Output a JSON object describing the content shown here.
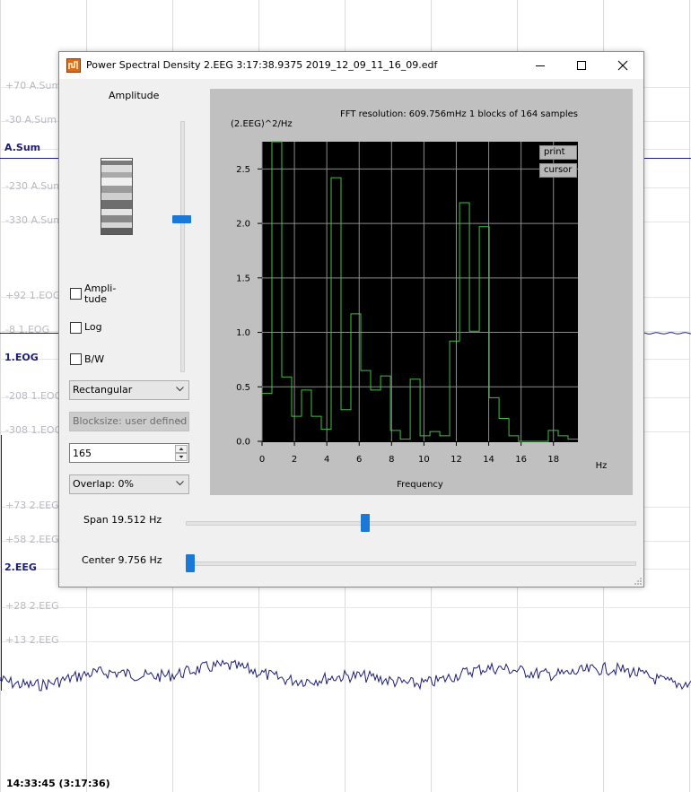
{
  "dialog": {
    "title": "Power Spectral Density    2.EEG   3:17:38.9375   2019_12_09_11_16_09.edf",
    "amplitude_label": "Amplitude",
    "checkboxes": {
      "amplitude": "Ampli-tude",
      "log": "Log",
      "bw": "B/W"
    },
    "window_select": "Rectangular",
    "blocksize_select": "Blocksize: user defined",
    "blocks_value": "165",
    "overlap_select": "Overlap: 0%",
    "span_label": "Span 19.512 Hz",
    "center_label": "Center 9.756 Hz",
    "print_label": "print",
    "cursor_label": "cursor"
  },
  "background": {
    "labels": [
      {
        "text": "+70 A.Sum",
        "channel": false
      },
      {
        "text": "-30 A.Sum",
        "channel": false
      },
      {
        "text": "A.Sum",
        "channel": true
      },
      {
        "text": "-230 A.Sum",
        "channel": false
      },
      {
        "text": "-330 A.Sum",
        "channel": false
      },
      {
        "text": "+92 1.EOG",
        "channel": false
      },
      {
        "text": "-8 1.EOG",
        "channel": false
      },
      {
        "text": "1.EOG",
        "channel": true
      },
      {
        "text": "-208 1.EOG",
        "channel": false
      },
      {
        "text": "-308 1.EOG",
        "channel": false
      },
      {
        "text": "+73 2.EEG",
        "channel": false
      },
      {
        "text": "+58 2.EEG",
        "channel": false
      },
      {
        "text": "2.EEG",
        "channel": true
      },
      {
        "text": "+28 2.EEG",
        "channel": false
      },
      {
        "text": "+13 2.EEG",
        "channel": false
      }
    ],
    "timestamp": "14:33:45 (3:17:36)",
    "trace_color": "#1d1d7a"
  },
  "chart_data": {
    "type": "line",
    "title": "FFT resolution: 609.756mHz   1 blocks of 164 samples",
    "ylabel": "(2.EEG)^2/Hz",
    "xlabel": "Frequency",
    "x_unit": "Hz",
    "xlim": [
      0,
      19.512
    ],
    "ylim": [
      0,
      2.75
    ],
    "x_ticks": [
      0,
      2,
      4,
      6,
      8,
      10,
      12,
      14,
      16,
      18
    ],
    "y_ticks": [
      0.0,
      0.5,
      1.0,
      1.5,
      2.0,
      2.5
    ],
    "y_tick_labels": [
      "0.0",
      "0.5",
      "1.0",
      "1.5",
      "2.0",
      "2.5"
    ],
    "grid": true,
    "step": true,
    "line_color": "#40c040",
    "background_color": "#000000",
    "x": [
      0.0,
      0.61,
      1.22,
      1.83,
      2.44,
      3.05,
      3.66,
      4.27,
      4.88,
      5.49,
      6.1,
      6.71,
      7.32,
      7.93,
      8.54,
      9.15,
      9.76,
      10.37,
      10.98,
      11.59,
      12.2,
      12.81,
      13.42,
      14.03,
      14.64,
      15.25,
      15.85,
      16.46,
      17.07,
      17.68,
      18.29,
      18.9
    ],
    "values": [
      0.44,
      2.75,
      0.59,
      0.23,
      0.47,
      0.23,
      0.11,
      2.42,
      0.29,
      1.17,
      0.65,
      0.47,
      0.6,
      0.1,
      0.02,
      0.57,
      0.05,
      0.09,
      0.05,
      0.92,
      2.19,
      1.01,
      1.97,
      0.4,
      0.21,
      0.05,
      0.0,
      0.0,
      0.0,
      0.1,
      0.05,
      0.02
    ]
  }
}
